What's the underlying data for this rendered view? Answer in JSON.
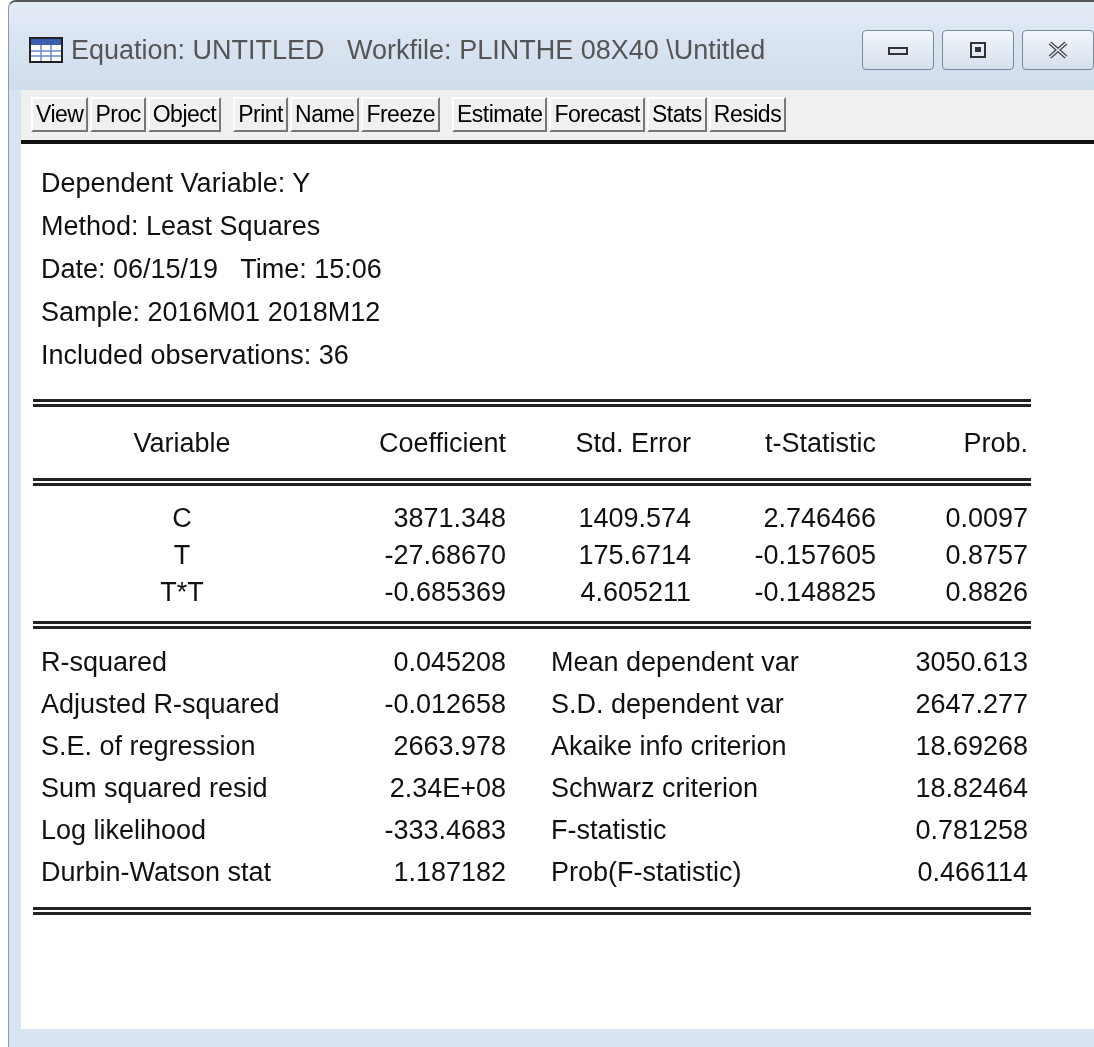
{
  "window": {
    "title": "Equation: UNTITLED   Workfile: PLINTHE 08X40 \\Untitled"
  },
  "toolbar": [
    [
      "View",
      "Proc",
      "Object"
    ],
    [
      "Print",
      "Name",
      "Freeze"
    ],
    [
      "Estimate",
      "Forecast",
      "Stats",
      "Resids"
    ]
  ],
  "header": [
    "Dependent Variable: Y",
    "Method: Least Squares",
    "Date: 06/15/19   Time: 15:06",
    "Sample: 2016M01 2018M12",
    "Included observations: 36"
  ],
  "table": {
    "columns": [
      "Variable",
      "Coefficient",
      "Std. Error",
      "t-Statistic",
      "Prob."
    ],
    "rows": [
      [
        "C",
        "3871.348",
        "1409.574",
        "2.746466",
        "0.0097"
      ],
      [
        "T",
        "-27.68670",
        "175.6714",
        "-0.157605",
        "0.8757"
      ],
      [
        "T*T",
        "-0.685369",
        "4.605211",
        "-0.148825",
        "0.8826"
      ]
    ]
  },
  "statistics": [
    [
      "R-squared",
      "0.045208",
      "Mean dependent var",
      "3050.613"
    ],
    [
      "Adjusted R-squared",
      "-0.012658",
      "S.D. dependent var",
      "2647.277"
    ],
    [
      "S.E. of regression",
      "2663.978",
      "Akaike info criterion",
      "18.69268"
    ],
    [
      "Sum squared resid",
      "2.34E+08",
      "Schwarz criterion",
      "18.82464"
    ],
    [
      "Log likelihood",
      "-333.4683",
      "F-statistic",
      "0.781258"
    ],
    [
      "Durbin-Watson stat",
      "1.187182",
      "Prob(F-statistic)",
      "0.466114"
    ]
  ]
}
